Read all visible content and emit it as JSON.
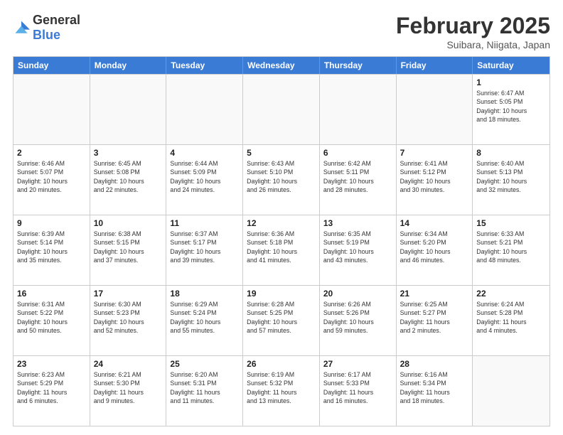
{
  "header": {
    "logo_general": "General",
    "logo_blue": "Blue",
    "month_title": "February 2025",
    "location": "Suibara, Niigata, Japan"
  },
  "weekdays": [
    "Sunday",
    "Monday",
    "Tuesday",
    "Wednesday",
    "Thursday",
    "Friday",
    "Saturday"
  ],
  "rows": [
    [
      {
        "date": "",
        "info": ""
      },
      {
        "date": "",
        "info": ""
      },
      {
        "date": "",
        "info": ""
      },
      {
        "date": "",
        "info": ""
      },
      {
        "date": "",
        "info": ""
      },
      {
        "date": "",
        "info": ""
      },
      {
        "date": "1",
        "info": "Sunrise: 6:47 AM\nSunset: 5:05 PM\nDaylight: 10 hours\nand 18 minutes."
      }
    ],
    [
      {
        "date": "2",
        "info": "Sunrise: 6:46 AM\nSunset: 5:07 PM\nDaylight: 10 hours\nand 20 minutes."
      },
      {
        "date": "3",
        "info": "Sunrise: 6:45 AM\nSunset: 5:08 PM\nDaylight: 10 hours\nand 22 minutes."
      },
      {
        "date": "4",
        "info": "Sunrise: 6:44 AM\nSunset: 5:09 PM\nDaylight: 10 hours\nand 24 minutes."
      },
      {
        "date": "5",
        "info": "Sunrise: 6:43 AM\nSunset: 5:10 PM\nDaylight: 10 hours\nand 26 minutes."
      },
      {
        "date": "6",
        "info": "Sunrise: 6:42 AM\nSunset: 5:11 PM\nDaylight: 10 hours\nand 28 minutes."
      },
      {
        "date": "7",
        "info": "Sunrise: 6:41 AM\nSunset: 5:12 PM\nDaylight: 10 hours\nand 30 minutes."
      },
      {
        "date": "8",
        "info": "Sunrise: 6:40 AM\nSunset: 5:13 PM\nDaylight: 10 hours\nand 32 minutes."
      }
    ],
    [
      {
        "date": "9",
        "info": "Sunrise: 6:39 AM\nSunset: 5:14 PM\nDaylight: 10 hours\nand 35 minutes."
      },
      {
        "date": "10",
        "info": "Sunrise: 6:38 AM\nSunset: 5:15 PM\nDaylight: 10 hours\nand 37 minutes."
      },
      {
        "date": "11",
        "info": "Sunrise: 6:37 AM\nSunset: 5:17 PM\nDaylight: 10 hours\nand 39 minutes."
      },
      {
        "date": "12",
        "info": "Sunrise: 6:36 AM\nSunset: 5:18 PM\nDaylight: 10 hours\nand 41 minutes."
      },
      {
        "date": "13",
        "info": "Sunrise: 6:35 AM\nSunset: 5:19 PM\nDaylight: 10 hours\nand 43 minutes."
      },
      {
        "date": "14",
        "info": "Sunrise: 6:34 AM\nSunset: 5:20 PM\nDaylight: 10 hours\nand 46 minutes."
      },
      {
        "date": "15",
        "info": "Sunrise: 6:33 AM\nSunset: 5:21 PM\nDaylight: 10 hours\nand 48 minutes."
      }
    ],
    [
      {
        "date": "16",
        "info": "Sunrise: 6:31 AM\nSunset: 5:22 PM\nDaylight: 10 hours\nand 50 minutes."
      },
      {
        "date": "17",
        "info": "Sunrise: 6:30 AM\nSunset: 5:23 PM\nDaylight: 10 hours\nand 52 minutes."
      },
      {
        "date": "18",
        "info": "Sunrise: 6:29 AM\nSunset: 5:24 PM\nDaylight: 10 hours\nand 55 minutes."
      },
      {
        "date": "19",
        "info": "Sunrise: 6:28 AM\nSunset: 5:25 PM\nDaylight: 10 hours\nand 57 minutes."
      },
      {
        "date": "20",
        "info": "Sunrise: 6:26 AM\nSunset: 5:26 PM\nDaylight: 10 hours\nand 59 minutes."
      },
      {
        "date": "21",
        "info": "Sunrise: 6:25 AM\nSunset: 5:27 PM\nDaylight: 11 hours\nand 2 minutes."
      },
      {
        "date": "22",
        "info": "Sunrise: 6:24 AM\nSunset: 5:28 PM\nDaylight: 11 hours\nand 4 minutes."
      }
    ],
    [
      {
        "date": "23",
        "info": "Sunrise: 6:23 AM\nSunset: 5:29 PM\nDaylight: 11 hours\nand 6 minutes."
      },
      {
        "date": "24",
        "info": "Sunrise: 6:21 AM\nSunset: 5:30 PM\nDaylight: 11 hours\nand 9 minutes."
      },
      {
        "date": "25",
        "info": "Sunrise: 6:20 AM\nSunset: 5:31 PM\nDaylight: 11 hours\nand 11 minutes."
      },
      {
        "date": "26",
        "info": "Sunrise: 6:19 AM\nSunset: 5:32 PM\nDaylight: 11 hours\nand 13 minutes."
      },
      {
        "date": "27",
        "info": "Sunrise: 6:17 AM\nSunset: 5:33 PM\nDaylight: 11 hours\nand 16 minutes."
      },
      {
        "date": "28",
        "info": "Sunrise: 6:16 AM\nSunset: 5:34 PM\nDaylight: 11 hours\nand 18 minutes."
      },
      {
        "date": "",
        "info": ""
      }
    ]
  ]
}
